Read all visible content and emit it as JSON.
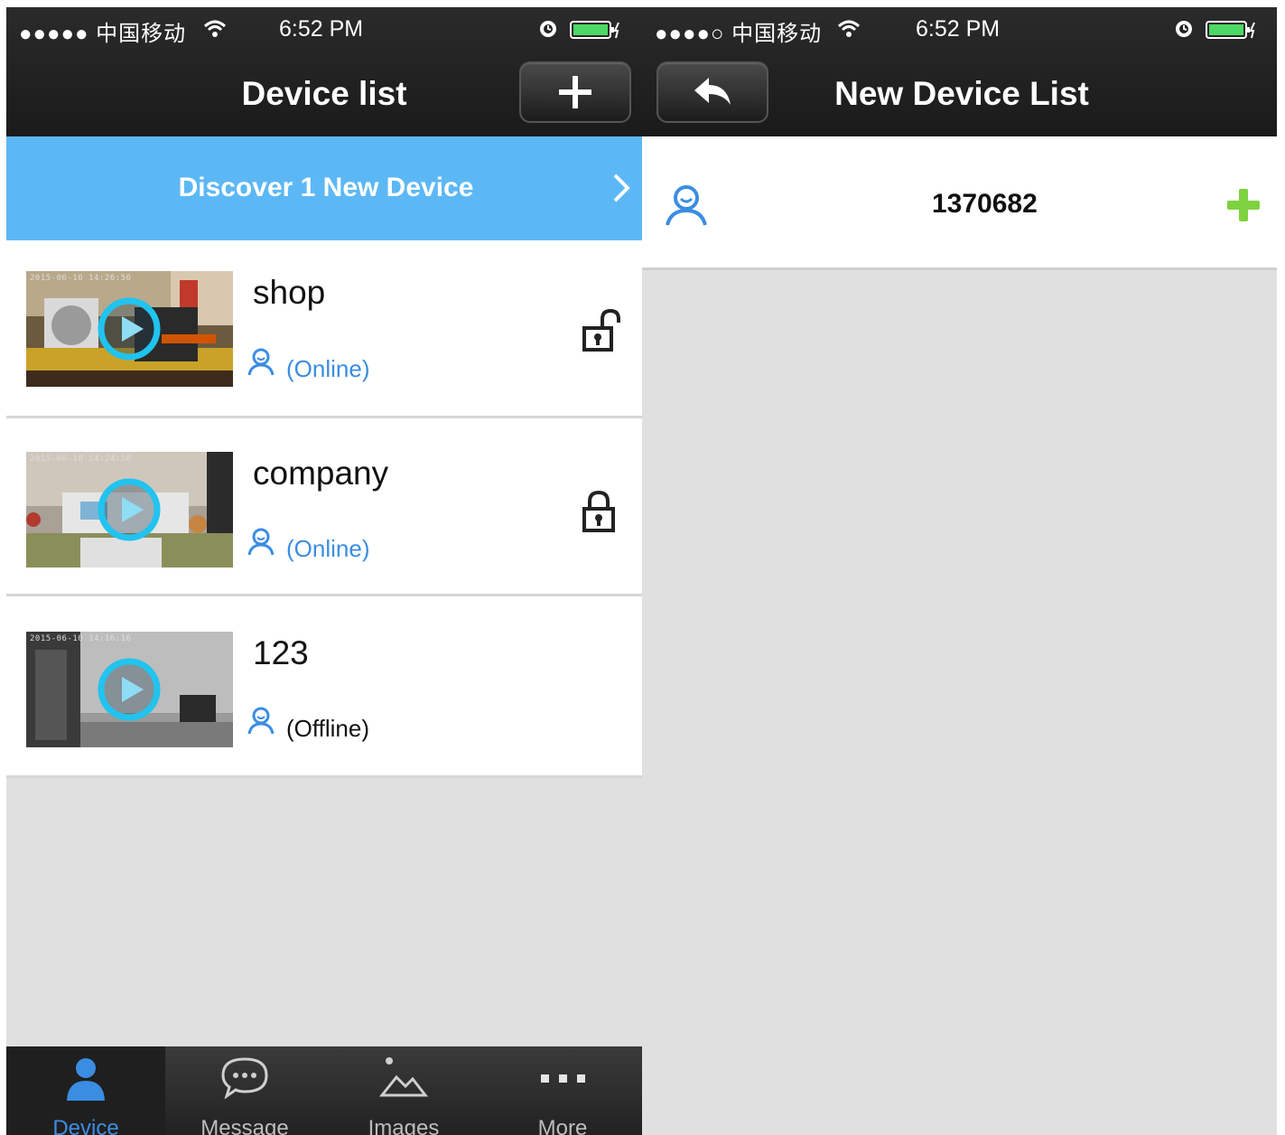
{
  "status": {
    "carrier": "中国移动",
    "time": "6:52 PM"
  },
  "device_list": {
    "title": "Device list",
    "banner_text": "Discover 1 New Device",
    "devices": [
      {
        "name": "shop",
        "status": "(Online)",
        "lock": "unlocked",
        "stamp": "2015-06-10 14:26:50"
      },
      {
        "name": "company",
        "status": "(Online)",
        "lock": "locked",
        "stamp": "2015-06-10 14:24:58"
      },
      {
        "name": "123",
        "status": "(Offline)",
        "lock": "none",
        "stamp": "2015-06-10 14:16:16"
      }
    ],
    "tabs": [
      {
        "label": "Device",
        "icon": "person-icon",
        "active": true
      },
      {
        "label": "Message",
        "icon": "chat-bubble-icon",
        "active": false
      },
      {
        "label": "Images",
        "icon": "image-icon",
        "active": false
      },
      {
        "label": "More",
        "icon": "more-dots-icon",
        "active": false
      }
    ]
  },
  "new_device_list": {
    "title": "New Device List",
    "devices": [
      {
        "id": "1370682"
      }
    ]
  },
  "colors": {
    "accent": "#5cb8f5",
    "online": "#3b8de2",
    "offline": "#111111",
    "add": "#7ed23f",
    "nav": "#1f1f1f"
  }
}
